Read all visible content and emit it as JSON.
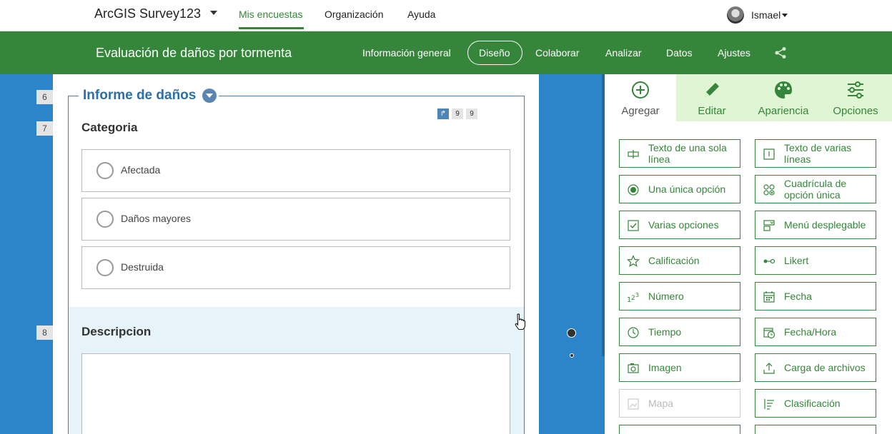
{
  "topnav": {
    "app_title": "ArcGIS Survey123",
    "links": [
      "Mis encuestas",
      "Organización",
      "Ayuda"
    ],
    "user": "Ismael"
  },
  "survey": {
    "title": "Evaluación de daños por tormenta",
    "tabs": [
      "Información general",
      "Diseño",
      "Colaborar",
      "Analizar",
      "Datos",
      "Ajustes"
    ],
    "active_tab": "Diseño"
  },
  "canvas": {
    "row_numbers": [
      "6",
      "7",
      "8"
    ],
    "group_title": "Informe de daños",
    "mini_badges": [
      "9",
      "9"
    ],
    "q7": {
      "label": "Categoria",
      "choices": [
        "Afectada",
        "Daños mayores",
        "Destruida"
      ]
    },
    "q8": {
      "label": "Descripcion"
    }
  },
  "panel": {
    "tabs": [
      {
        "label": "Agregar",
        "icon": "plus-circle-icon"
      },
      {
        "label": "Editar",
        "icon": "pencil-icon"
      },
      {
        "label": "Apariencia",
        "icon": "palette-icon"
      },
      {
        "label": "Opciones",
        "icon": "sliders-icon"
      }
    ],
    "active_tab": "Agregar",
    "question_types": [
      {
        "label": "Texto de una sola línea",
        "icon": "single-line-text-icon"
      },
      {
        "label": "Texto de varias líneas",
        "icon": "multiline-text-icon"
      },
      {
        "label": "Una única opción",
        "icon": "radio-icon"
      },
      {
        "label": "Cuadrícula de opción única",
        "icon": "radio-grid-icon"
      },
      {
        "label": "Varias opciones",
        "icon": "checkbox-icon"
      },
      {
        "label": "Menú desplegable",
        "icon": "dropdown-icon"
      },
      {
        "label": "Calificación",
        "icon": "star-icon"
      },
      {
        "label": "Likert",
        "icon": "likert-icon"
      },
      {
        "label": "Número",
        "icon": "number-icon"
      },
      {
        "label": "Fecha",
        "icon": "calendar-icon"
      },
      {
        "label": "Tiempo",
        "icon": "clock-icon"
      },
      {
        "label": "Fecha/Hora",
        "icon": "calendar-clock-icon"
      },
      {
        "label": "Imagen",
        "icon": "camera-icon"
      },
      {
        "label": "Carga de archivos",
        "icon": "upload-icon"
      },
      {
        "label": "Mapa",
        "icon": "map-icon",
        "disabled": true
      },
      {
        "label": "Clasificación",
        "icon": "ranking-icon"
      }
    ]
  },
  "colors": {
    "green": "#35863a",
    "blue": "#2b85c8",
    "light_green": "#dff5d4",
    "light_blue": "#e6f3f8"
  }
}
